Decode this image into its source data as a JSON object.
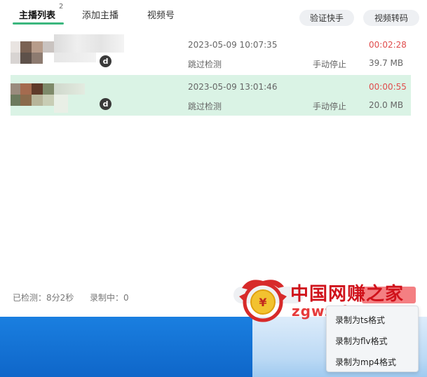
{
  "tabs": [
    {
      "label": "主播列表",
      "badge": "2"
    },
    {
      "label": "添加主播"
    },
    {
      "label": "视频号"
    }
  ],
  "header_buttons": {
    "verify": "验证快手",
    "transcode": "视频转码"
  },
  "rows": [
    {
      "avatar_letter": "d",
      "datetime": "2023-05-09 10:07:35",
      "duration": "00:02:28",
      "detect": "跳过检测",
      "stop": "手动停止",
      "size": "39.7 MB"
    },
    {
      "avatar_letter": "d",
      "datetime": "2023-05-09 13:01:46",
      "duration": "00:00:55",
      "detect": "跳过检测",
      "stop": "手动停止",
      "size": "20.0 MB"
    }
  ],
  "footer": {
    "checked": "已检测：8分2秒",
    "recording": "录制中：0"
  },
  "context_menu": {
    "items": [
      "录制为ts格式",
      "录制为flv格式",
      "录制为mp4格式"
    ]
  },
  "watermark": {
    "cn": "中国网赚之家",
    "url": "zgwzzj.com"
  },
  "colors": {
    "accent": "#3bb77e",
    "selected_row": "#daf3e5",
    "duration_red": "#e04b4b",
    "record_button": "#f47f82",
    "taskbar": "#1a7fe0"
  }
}
